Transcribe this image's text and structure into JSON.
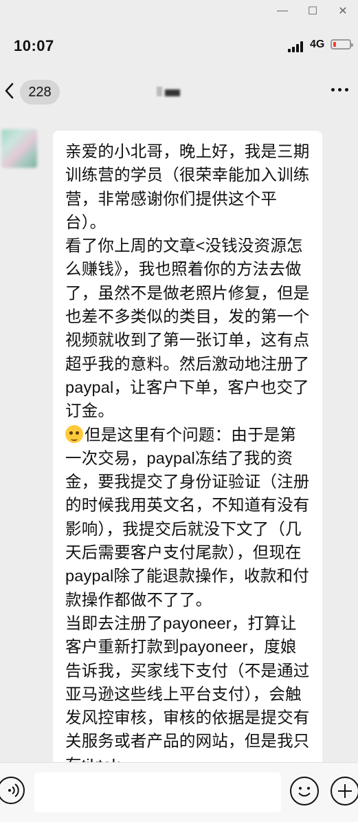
{
  "window": {
    "minimize_glyph": "—",
    "maximize_glyph": "☐",
    "close_glyph": "✕"
  },
  "status_bar": {
    "time": "10:07",
    "network": "4G",
    "battery_level": 0.15,
    "battery_color": "#ff3b30"
  },
  "nav": {
    "back_icon": "chevron-left",
    "unread_count": "228",
    "more_icon": "ellipsis"
  },
  "chat": {
    "bubble_color": "#ffffff",
    "background_color": "#ededed",
    "message_part1": "亲爱的小北哥，晚上好，我是三期训练营的学员（很荣幸能加入训练营，非常感谢你们提供这个平台）。\n看了你上周的文章<没钱没资源怎么赚钱》，我也照着你的方法去做了，虽然不是做老照片修复，但是也差不多类似的类目，发的第一个视频就收到了第一张订单，这有点超乎我的意料。然后激动地注册了paypal，让客户下单，客户也交了订金。\n",
    "emoji_name": "flushed-face-emoji",
    "message_part2": "但是这里有个问题：由于是第一次交易，paypal冻结了我的资金，要我提交了身份证验证（注册的时候我用英文名，不知道有没有影响），我提交后就没下文了（几天后需要客户支付尾款），但现在paypal除了能退款操作，收款和付款操作都做不了了。\n当即去注册了payoneer，打算让客户重新打款到payoneer，度娘告诉我，买家线下支付（不是通过亚马逊这些线上平台支付），会触发风控审核，审核的依据是提交有关服务或者产品的网站，但是我只有tiktok"
  },
  "input_bar": {
    "voice_icon": "voice-icon",
    "input_value": "",
    "emoji_icon": "smiley-icon",
    "plus_icon": "plus-icon"
  }
}
